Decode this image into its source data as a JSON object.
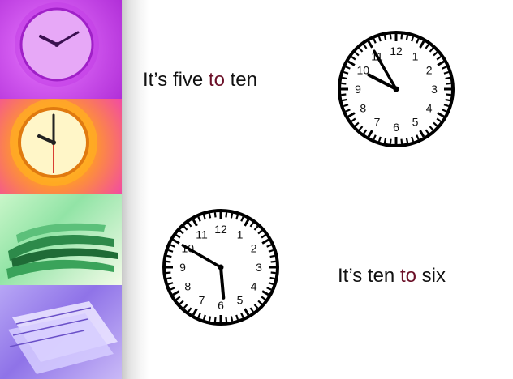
{
  "captions": [
    {
      "before": "It’s five ",
      "highlight": "to",
      "after": " ten"
    },
    {
      "before": "It’s ten ",
      "highlight": "to",
      "after": " six"
    }
  ],
  "clocks": [
    {
      "hour": 9,
      "minute": 55
    },
    {
      "hour": 5,
      "minute": 50
    }
  ],
  "clock_numbers": [
    "12",
    "1",
    "2",
    "3",
    "4",
    "5",
    "6",
    "7",
    "8",
    "9",
    "10",
    "11"
  ],
  "colors": {
    "highlight": "#6b1028",
    "text": "#111111"
  }
}
